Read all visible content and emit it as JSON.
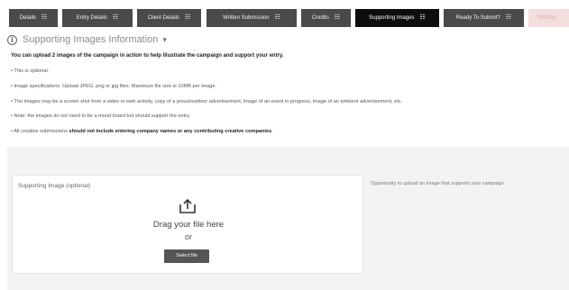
{
  "tabs": [
    {
      "label": "Details",
      "state": "normal"
    },
    {
      "label": "Entry Details",
      "state": "normal"
    },
    {
      "label": "Client Details",
      "state": "normal"
    },
    {
      "label": "Written Submission",
      "state": "normal"
    },
    {
      "label": "Credits",
      "state": "normal"
    },
    {
      "label": "Supporting Images",
      "state": "active"
    },
    {
      "label": "Ready To Submit?",
      "state": "normal"
    },
    {
      "label": "Shortlis",
      "state": "faded"
    }
  ],
  "section": {
    "title": "Supporting Images Information"
  },
  "instructions": {
    "intro": "You can upload 2 images of the campaign in action to help illustrate the campaign and support your entry.",
    "bullets": [
      "• This is optional.",
      "• Image specifications: Upload JPEG, png or jpg files. Maximum file size is 10MB per image.",
      "• The images may be a screen shot from a video or web activity, copy of a press/outdoor advertisement, image of an event in progress, image of an ambient advertisement, etc.",
      "• Note: the images do not need to be a mood board but should support the entry."
    ],
    "last_bullet": {
      "prefix": "• All creative submissions ",
      "bold": "should not include entering company names or any contributing creative companies",
      "suffix": "."
    }
  },
  "upload": {
    "label": "Supporting Image (optional)",
    "drag_text": "Drag your file here",
    "or_text": "or",
    "button_label": "Select file",
    "help_text": "Opportunity to upload an image that supports your campaign"
  }
}
